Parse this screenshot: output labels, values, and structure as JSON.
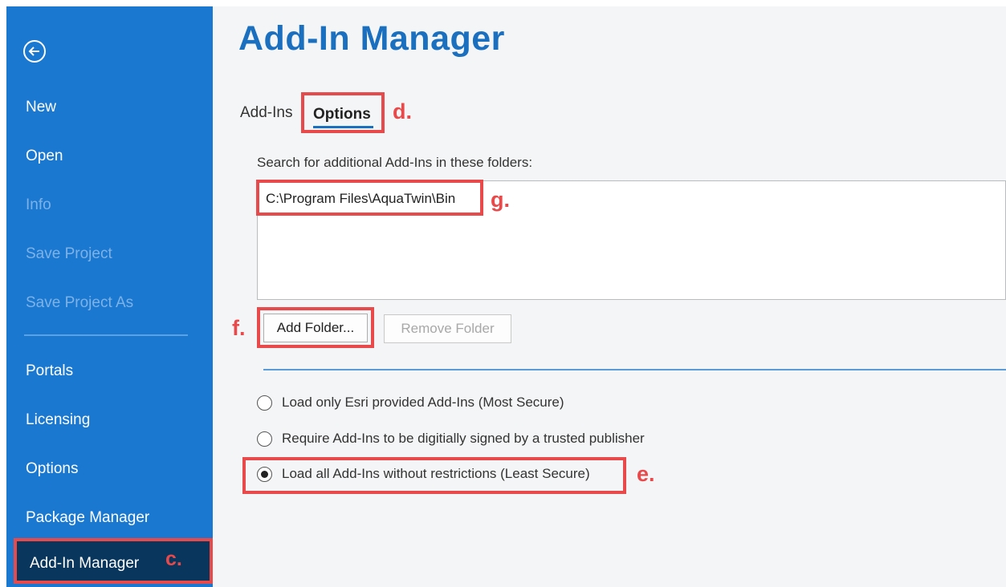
{
  "sidebar": {
    "items": [
      {
        "label": "New",
        "enabled": true
      },
      {
        "label": "Open",
        "enabled": true
      },
      {
        "label": "Info",
        "enabled": false
      },
      {
        "label": "Save Project",
        "enabled": false
      },
      {
        "label": "Save Project As",
        "enabled": false
      },
      {
        "label": "Portals",
        "enabled": true
      },
      {
        "label": "Licensing",
        "enabled": true
      },
      {
        "label": "Options",
        "enabled": true
      },
      {
        "label": "Package Manager",
        "enabled": true
      },
      {
        "label": "Add-In Manager",
        "enabled": true,
        "active": true
      }
    ]
  },
  "main": {
    "title": "Add-In Manager",
    "tabs": [
      {
        "label": "Add-Ins"
      },
      {
        "label": "Options",
        "selected": true
      }
    ],
    "search_label": "Search for additional Add-Ins in these folders:",
    "folders": [
      "C:\\Program Files\\AquaTwin\\Bin"
    ],
    "add_folder_label": "Add Folder...",
    "remove_folder_label": "Remove Folder",
    "security_options": [
      {
        "label": "Load only Esri provided Add-Ins (Most Secure)",
        "checked": false
      },
      {
        "label": "Require Add-Ins to be digitially signed by a trusted publisher",
        "checked": false
      },
      {
        "label": "Load all Add-Ins without restrictions (Least Secure)",
        "checked": true
      }
    ]
  },
  "annotations": {
    "c": "c.",
    "d": "d.",
    "e": "e.",
    "f": "f.",
    "g": "g."
  },
  "colors": {
    "sidebar_bg": "#1a78d1",
    "sidebar_active_bg": "#08365d",
    "title_blue": "#1b6fbf",
    "highlight_red": "#e8494a"
  }
}
